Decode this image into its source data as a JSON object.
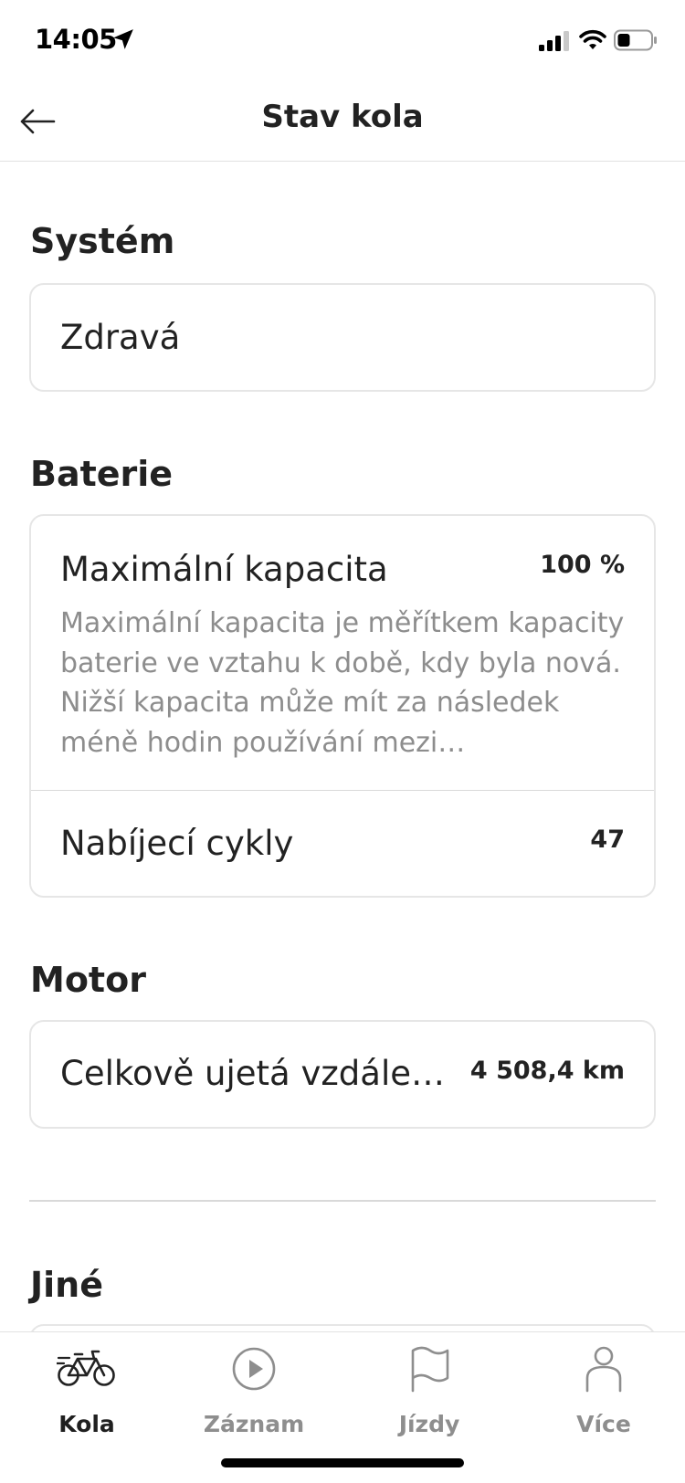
{
  "status_bar": {
    "time": "14:05"
  },
  "header": {
    "title": "Stav kola"
  },
  "sections": {
    "system": {
      "title": "Systém",
      "value": "Zdravá"
    },
    "battery": {
      "title": "Baterie",
      "max_capacity_label": "Maximální kapacita",
      "max_capacity_value": "100 %",
      "max_capacity_desc": "Maximální kapacita je měřítkem kapacity baterie ve vztahu k době, kdy byla nová. Nižší kapacita může mít za následek méně hodin používání mezi…",
      "charge_cycles_label": "Nabíjecí cykly",
      "charge_cycles_value": "47"
    },
    "motor": {
      "title": "Motor",
      "distance_label": "Celkově ujetá vzdále…",
      "distance_value": "4 508,4 km"
    },
    "other": {
      "title": "Jiné"
    }
  },
  "bottom_nav": {
    "items": [
      {
        "label": "Kola",
        "icon": "bike-icon",
        "active": true
      },
      {
        "label": "Záznam",
        "icon": "play-circle-icon",
        "active": false
      },
      {
        "label": "Jízdy",
        "icon": "flag-icon",
        "active": false
      },
      {
        "label": "Více",
        "icon": "person-icon",
        "active": false
      }
    ]
  },
  "colors": {
    "active_nav": "#1f1f1f",
    "inactive_nav": "#8e8e8e",
    "secondary_text": "#8d8d8d",
    "card_border": "#e6e6e6"
  }
}
